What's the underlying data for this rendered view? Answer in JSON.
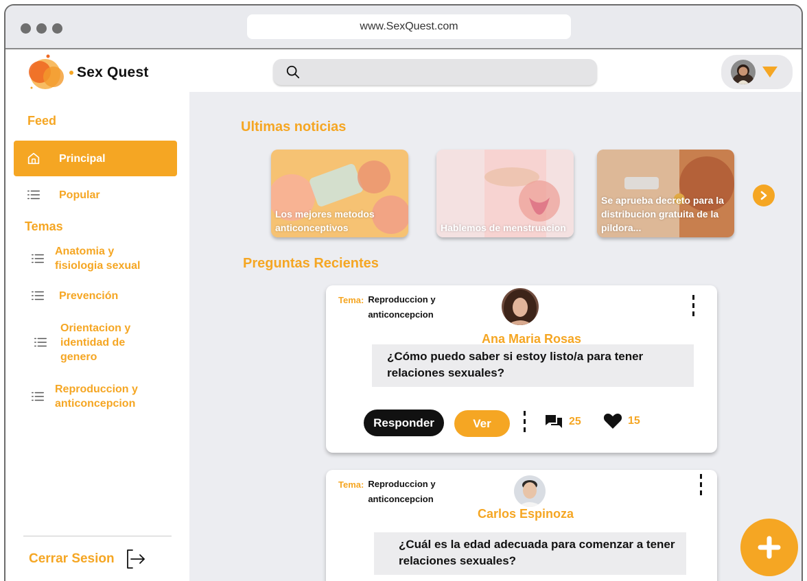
{
  "browser": {
    "url": "www.SexQuest.com"
  },
  "app": {
    "brand": "Sex Quest"
  },
  "search": {
    "placeholder": ""
  },
  "sidebar": {
    "feed_heading": "Feed",
    "feed_items": [
      {
        "label": "Principal",
        "icon": "home-icon",
        "active": true
      },
      {
        "label": "Popular",
        "icon": "list-icon",
        "active": false
      }
    ],
    "topics_heading": "Temas",
    "topic_items": [
      {
        "label": "Anatomia y fisiologia sexual",
        "icon": "list-icon"
      },
      {
        "label": "Prevención",
        "icon": "list-icon"
      },
      {
        "label": "Orientacion y identidad de genero",
        "icon": "list-icon"
      },
      {
        "label": "Reproduccion y anticoncepcion",
        "icon": "list-icon"
      }
    ],
    "logout_label": "Cerrar Sesion"
  },
  "news": {
    "title": "Ultimas noticias",
    "items": [
      {
        "caption": "Los mejores metodos anticonceptivos"
      },
      {
        "caption": "Hablemos de menstruacion"
      },
      {
        "caption": "Se aprueba decreto para la distribucion gratuita de la pildora..."
      }
    ]
  },
  "questions": {
    "title": "Preguntas Recientes",
    "topic_key": "Tema:",
    "items": [
      {
        "topic": "Reproduccion y anticoncepcion",
        "author": "Ana Maria Rosas",
        "question": "¿Cómo puedo saber si estoy listo/a para tener relaciones sexuales?",
        "reply_label": "Responder",
        "view_label": "Ver",
        "comments": "25",
        "likes": "15"
      },
      {
        "topic": "Reproduccion y anticoncepcion",
        "author": "Carlos Espinoza",
        "question": "¿Cuál es la edad adecuada para comenzar a tener relaciones sexuales?"
      }
    ]
  },
  "colors": {
    "accent": "#f5a623",
    "background": "#ecedf1",
    "dark": "#111111"
  }
}
